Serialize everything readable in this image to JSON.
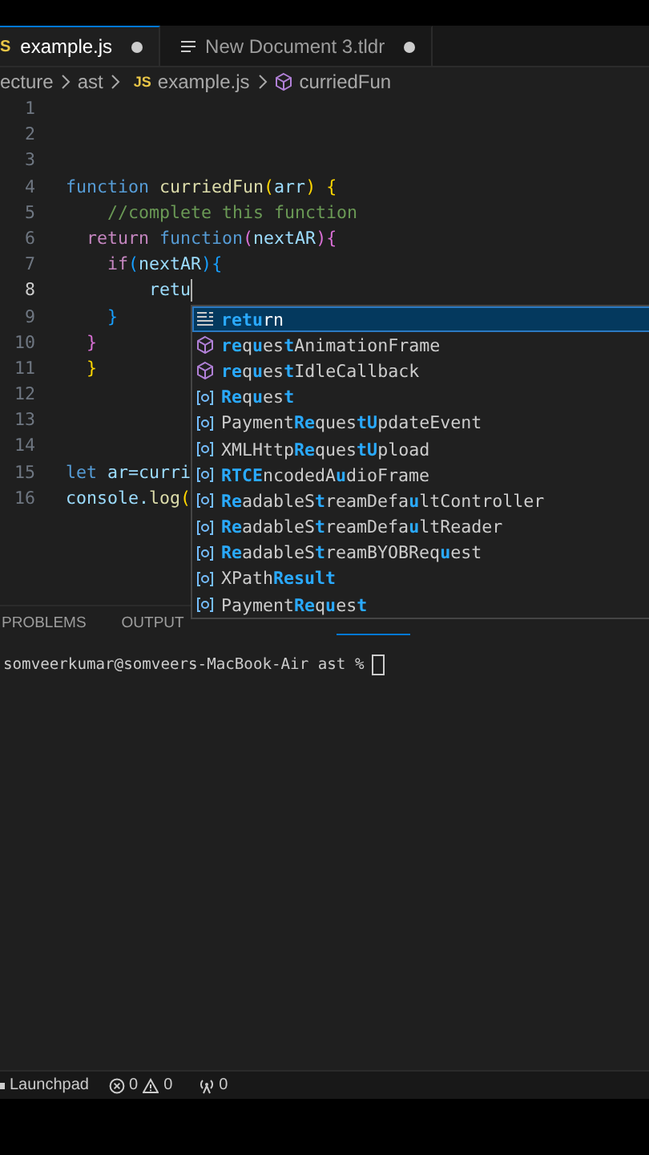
{
  "tabs": [
    {
      "icon_text": "S",
      "label": "example.js",
      "modified": true,
      "selected": true
    },
    {
      "label": "New Document 3.tldr",
      "modified": true,
      "selected": false
    }
  ],
  "breadcrumb": [
    {
      "kind": "text",
      "label": "ecture"
    },
    {
      "kind": "text",
      "label": "ast"
    },
    {
      "kind": "file",
      "badge": "JS",
      "label": "example.js"
    },
    {
      "kind": "symbol",
      "label": "curriedFun"
    }
  ],
  "code_lines": [
    {
      "number": "1",
      "current": false
    },
    {
      "number": "2",
      "current": false
    },
    {
      "number": "3",
      "current": false
    },
    {
      "number": "4",
      "current": false,
      "tokens": [
        {
          "kind": "keyword",
          "text": "function"
        },
        {
          "kind": "fn",
          "text": " curriedFun"
        },
        {
          "kind": "bracket1",
          "text": "("
        },
        {
          "kind": "param",
          "text": "arr"
        },
        {
          "kind": "bracket1",
          "text": ")"
        },
        {
          "kind": "bracket1",
          "text": " {"
        }
      ]
    },
    {
      "number": "5",
      "current": false,
      "tokens": [
        {
          "kind": "comment",
          "text": "    //complete this function"
        }
      ]
    },
    {
      "number": "6",
      "current": false,
      "tokens": [
        {
          "kind": "control",
          "text": "  return"
        },
        {
          "kind": "keyword",
          "text": " function"
        },
        {
          "kind": "bracket2",
          "text": "("
        },
        {
          "kind": "param",
          "text": "nextAR"
        },
        {
          "kind": "bracket2",
          "text": ")"
        },
        {
          "kind": "bracket2",
          "text": "{"
        }
      ]
    },
    {
      "number": "7",
      "current": false,
      "tokens": [
        {
          "kind": "control",
          "text": "    if"
        },
        {
          "kind": "bracket3",
          "text": "("
        },
        {
          "kind": "param",
          "text": "nextAR"
        },
        {
          "kind": "bracket3",
          "text": ")"
        },
        {
          "kind": "bracket3",
          "text": "{"
        }
      ]
    },
    {
      "number": "8",
      "current": true,
      "tokens": [
        {
          "kind": "param",
          "text": "        retu"
        }
      ]
    },
    {
      "number": "9",
      "current": false,
      "tokens": [
        {
          "kind": "bracket3",
          "text": "    }"
        }
      ]
    },
    {
      "number": "10",
      "current": false,
      "tokens": [
        {
          "kind": "bracket2",
          "text": "  }"
        }
      ]
    },
    {
      "number": "11",
      "current": false,
      "tokens": [
        {
          "kind": "bracket1",
          "text": "  }"
        }
      ]
    },
    {
      "number": "12",
      "current": false
    },
    {
      "number": "13",
      "current": false
    },
    {
      "number": "14",
      "current": false
    },
    {
      "number": "15",
      "current": false,
      "tokens": [
        {
          "kind": "keyword",
          "text": "let"
        },
        {
          "kind": "param",
          "text": " ar=curri"
        }
      ]
    },
    {
      "number": "16",
      "current": false,
      "tokens": [
        {
          "kind": "param",
          "text": "console."
        },
        {
          "kind": "fn",
          "text": "log"
        },
        {
          "kind": "bracket1",
          "text": "("
        }
      ]
    }
  ],
  "suggestions": [
    {
      "kind": "keyword",
      "selected": true,
      "parts": [
        {
          "text": "retu",
          "match": true
        },
        {
          "text": "rn",
          "match": false
        }
      ]
    },
    {
      "kind": "method",
      "selected": false,
      "parts": [
        {
          "text": "re",
          "match": true
        },
        {
          "text": "q",
          "match": false
        },
        {
          "text": "u",
          "match": true
        },
        {
          "text": "es",
          "match": false
        },
        {
          "text": "t",
          "match": true
        },
        {
          "text": "AnimationFrame",
          "match": false
        }
      ]
    },
    {
      "kind": "method",
      "selected": false,
      "parts": [
        {
          "text": "re",
          "match": true
        },
        {
          "text": "q",
          "match": false
        },
        {
          "text": "u",
          "match": true
        },
        {
          "text": "es",
          "match": false
        },
        {
          "text": "t",
          "match": true
        },
        {
          "text": "IdleCallback",
          "match": false
        }
      ]
    },
    {
      "kind": "variable",
      "selected": false,
      "parts": [
        {
          "text": "Re",
          "match": true
        },
        {
          "text": "q",
          "match": false
        },
        {
          "text": "u",
          "match": true
        },
        {
          "text": "es",
          "match": false
        },
        {
          "text": "t",
          "match": true
        }
      ]
    },
    {
      "kind": "variable",
      "selected": false,
      "parts": [
        {
          "text": "Payment",
          "match": false
        },
        {
          "text": "Re",
          "match": true
        },
        {
          "text": "ques",
          "match": false
        },
        {
          "text": "tU",
          "match": true
        },
        {
          "text": "pdateEvent",
          "match": false
        }
      ]
    },
    {
      "kind": "variable",
      "selected": false,
      "parts": [
        {
          "text": "XMLHttp",
          "match": false
        },
        {
          "text": "Re",
          "match": true
        },
        {
          "text": "ques",
          "match": false
        },
        {
          "text": "tU",
          "match": true
        },
        {
          "text": "pload",
          "match": false
        }
      ]
    },
    {
      "kind": "variable",
      "selected": false,
      "parts": [
        {
          "text": "RTCE",
          "match": true
        },
        {
          "text": "ncodedA",
          "match": false
        },
        {
          "text": "u",
          "match": true
        },
        {
          "text": "dioFrame",
          "match": false
        }
      ]
    },
    {
      "kind": "variable",
      "selected": false,
      "parts": [
        {
          "text": "Re",
          "match": true
        },
        {
          "text": "adableS",
          "match": false
        },
        {
          "text": "t",
          "match": true
        },
        {
          "text": "reamDefa",
          "match": false
        },
        {
          "text": "u",
          "match": true
        },
        {
          "text": "ltController",
          "match": false
        }
      ]
    },
    {
      "kind": "variable",
      "selected": false,
      "parts": [
        {
          "text": "Re",
          "match": true
        },
        {
          "text": "adableS",
          "match": false
        },
        {
          "text": "t",
          "match": true
        },
        {
          "text": "reamDefa",
          "match": false
        },
        {
          "text": "u",
          "match": true
        },
        {
          "text": "ltReader",
          "match": false
        }
      ]
    },
    {
      "kind": "variable",
      "selected": false,
      "parts": [
        {
          "text": "Re",
          "match": true
        },
        {
          "text": "adableS",
          "match": false
        },
        {
          "text": "t",
          "match": true
        },
        {
          "text": "reamBYOBReq",
          "match": false
        },
        {
          "text": "u",
          "match": true
        },
        {
          "text": "est",
          "match": false
        }
      ]
    },
    {
      "kind": "variable",
      "selected": false,
      "parts": [
        {
          "text": "XPath",
          "match": false
        },
        {
          "text": "Result",
          "match": true
        }
      ]
    },
    {
      "kind": "variable",
      "selected": false,
      "parts": [
        {
          "text": "Payment",
          "match": false
        },
        {
          "text": "Re",
          "match": true
        },
        {
          "text": "q",
          "match": false
        },
        {
          "text": "u",
          "match": true
        },
        {
          "text": "es",
          "match": false
        },
        {
          "text": "t",
          "match": true
        }
      ]
    }
  ],
  "panel_tabs": [
    {
      "label": "PROBLEMS",
      "selected": false
    },
    {
      "label": "OUTPUT",
      "selected": false
    }
  ],
  "terminal": {
    "prompt": "somveerkumar@somveers-MacBook-Air ast %"
  },
  "status_bar": {
    "launchpad": "Launchpad",
    "errors": "0",
    "warnings": "0",
    "ports": "0"
  }
}
